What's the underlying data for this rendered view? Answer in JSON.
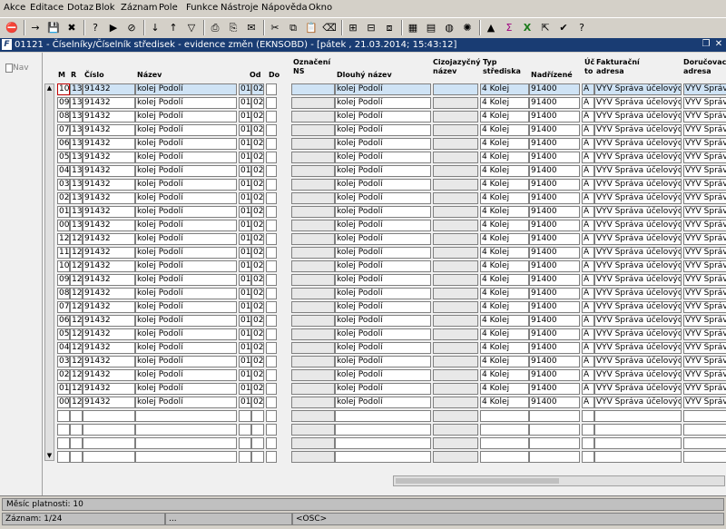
{
  "menu": [
    "Akce",
    "Editace",
    "Dotaz",
    "Blok",
    "Záznam",
    "Pole",
    "Funkce",
    "Nástroje",
    "Nápověda",
    "Okno"
  ],
  "window": {
    "title": "01121 - Číselníky/Číselník středisek - evidence změn (EKNSOBD) - [pátek , 21.03.2014; 15:43:12]"
  },
  "nav": {
    "label": "Nav"
  },
  "columns": {
    "m": "M",
    "r": "R",
    "cislo": "Číslo",
    "nazev": "Název",
    "od": "Od",
    "do": "Do",
    "oznaceni_ns": "Označení\nNS",
    "dlouhy_nazev": "Dlouhý název",
    "cizojazycny_nazev": "Cizojazyčný\nnázev",
    "typ_strediska": "Typ\nstřediska",
    "nadrizene": "Nadřízené",
    "ucto": "Úč\nto",
    "fakturacni_adresa": "Fakturační\nadresa",
    "dorucovaci_adresa": "Doručovac\nadresa"
  },
  "rows": [
    [
      "10",
      "13",
      "91432",
      "kolej Podolí",
      "01",
      "02",
      "",
      "kolej Podolí",
      "",
      "4 Kolej",
      "91400",
      "A",
      "VYV Správa účelových",
      "VYV Správ"
    ],
    [
      "09",
      "13",
      "91432",
      "kolej Podolí",
      "01",
      "02",
      "",
      "kolej Podolí",
      "",
      "4 Kolej",
      "91400",
      "A",
      "VYV Správa účelových",
      "VYV Správ"
    ],
    [
      "08",
      "13",
      "91432",
      "kolej Podolí",
      "01",
      "02",
      "",
      "kolej Podolí",
      "",
      "4 Kolej",
      "91400",
      "A",
      "VYV Správa účelových",
      "VYV Správ"
    ],
    [
      "07",
      "13",
      "91432",
      "kolej Podolí",
      "01",
      "02",
      "",
      "kolej Podolí",
      "",
      "4 Kolej",
      "91400",
      "A",
      "VYV Správa účelových",
      "VYV Správ"
    ],
    [
      "06",
      "13",
      "91432",
      "kolej Podolí",
      "01",
      "02",
      "",
      "kolej Podolí",
      "",
      "4 Kolej",
      "91400",
      "A",
      "VYV Správa účelových",
      "VYV Správ"
    ],
    [
      "05",
      "13",
      "91432",
      "kolej Podolí",
      "01",
      "02",
      "",
      "kolej Podolí",
      "",
      "4 Kolej",
      "91400",
      "A",
      "VYV Správa účelových",
      "VYV Správ"
    ],
    [
      "04",
      "13",
      "91432",
      "kolej Podolí",
      "01",
      "02",
      "",
      "kolej Podolí",
      "",
      "4 Kolej",
      "91400",
      "A",
      "VYV Správa účelových",
      "VYV Správ"
    ],
    [
      "03",
      "13",
      "91432",
      "kolej Podolí",
      "01",
      "02",
      "",
      "kolej Podolí",
      "",
      "4 Kolej",
      "91400",
      "A",
      "VYV Správa účelových",
      "VYV Správ"
    ],
    [
      "02",
      "13",
      "91432",
      "kolej Podolí",
      "01",
      "02",
      "",
      "kolej Podolí",
      "",
      "4 Kolej",
      "91400",
      "A",
      "VYV Správa účelových",
      "VYV Správ"
    ],
    [
      "01",
      "13",
      "91432",
      "kolej Podolí",
      "01",
      "02",
      "",
      "kolej Podolí",
      "",
      "4 Kolej",
      "91400",
      "A",
      "VYV Správa účelových",
      "VYV Správ"
    ],
    [
      "00",
      "13",
      "91432",
      "kolej Podolí",
      "01",
      "02",
      "",
      "kolej Podolí",
      "",
      "4 Kolej",
      "91400",
      "A",
      "VYV Správa účelových",
      "VYV Správ"
    ],
    [
      "12",
      "12",
      "91432",
      "kolej Podolí",
      "01",
      "02",
      "",
      "kolej Podolí",
      "",
      "4 Kolej",
      "91400",
      "A",
      "VYV Správa účelových",
      "VYV Správ"
    ],
    [
      "11",
      "12",
      "91432",
      "kolej Podolí",
      "01",
      "02",
      "",
      "kolej Podolí",
      "",
      "4 Kolej",
      "91400",
      "A",
      "VYV Správa účelových",
      "VYV Správ"
    ],
    [
      "10",
      "12",
      "91432",
      "kolej Podolí",
      "01",
      "02",
      "",
      "kolej Podolí",
      "",
      "4 Kolej",
      "91400",
      "A",
      "VYV Správa účelových",
      "VYV Správ"
    ],
    [
      "09",
      "12",
      "91432",
      "kolej Podolí",
      "01",
      "02",
      "",
      "kolej Podolí",
      "",
      "4 Kolej",
      "91400",
      "A",
      "VYV Správa účelových",
      "VYV Správ"
    ],
    [
      "08",
      "12",
      "91432",
      "kolej Podolí",
      "01",
      "02",
      "",
      "kolej Podolí",
      "",
      "4 Kolej",
      "91400",
      "A",
      "VYV Správa účelových",
      "VYV Správ"
    ],
    [
      "07",
      "12",
      "91432",
      "kolej Podolí",
      "01",
      "02",
      "",
      "kolej Podolí",
      "",
      "4 Kolej",
      "91400",
      "A",
      "VYV Správa účelových",
      "VYV Správ"
    ],
    [
      "06",
      "12",
      "91432",
      "kolej Podolí",
      "01",
      "02",
      "",
      "kolej Podolí",
      "",
      "4 Kolej",
      "91400",
      "A",
      "VYV Správa účelových",
      "VYV Správ"
    ],
    [
      "05",
      "12",
      "91432",
      "kolej Podolí",
      "01",
      "02",
      "",
      "kolej Podolí",
      "",
      "4 Kolej",
      "91400",
      "A",
      "VYV Správa účelových",
      "VYV Správ"
    ],
    [
      "04",
      "12",
      "91432",
      "kolej Podolí",
      "01",
      "02",
      "",
      "kolej Podolí",
      "",
      "4 Kolej",
      "91400",
      "A",
      "VYV Správa účelových",
      "VYV Správ"
    ],
    [
      "03",
      "12",
      "91432",
      "kolej Podolí",
      "01",
      "02",
      "",
      "kolej Podolí",
      "",
      "4 Kolej",
      "91400",
      "A",
      "VYV Správa účelových",
      "VYV Správ"
    ],
    [
      "02",
      "12",
      "91432",
      "kolej Podolí",
      "01",
      "02",
      "",
      "kolej Podolí",
      "",
      "4 Kolej",
      "91400",
      "A",
      "VYV Správa účelových",
      "VYV Správ"
    ],
    [
      "01",
      "12",
      "91432",
      "kolej Podolí",
      "01",
      "02",
      "",
      "kolej Podolí",
      "",
      "4 Kolej",
      "91400",
      "A",
      "VYV Správa účelových",
      "VYV Správ"
    ],
    [
      "00",
      "12",
      "91432",
      "kolej Podolí",
      "01",
      "02",
      "",
      "kolej Podolí",
      "",
      "4 Kolej",
      "91400",
      "A",
      "VYV Správa účelových",
      "VYV Správ"
    ]
  ],
  "empty_row_count": 4,
  "toolbar_icons": [
    "exit-icon",
    "separator",
    "arrow-icon",
    "save-icon",
    "cancel-icon",
    "separator",
    "enter-query-icon",
    "execute-query-icon",
    "cancel-query-icon",
    "separator",
    "sort-asc-icon",
    "sort-desc-icon",
    "filter-icon",
    "separator",
    "print-icon",
    "print-preview-icon",
    "mail-icon",
    "separator",
    "cut-icon",
    "copy-icon",
    "paste-icon",
    "clear-icon",
    "separator",
    "insert-record-icon",
    "delete-record-icon",
    "duplicate-icon",
    "separator",
    "calculator-icon",
    "calendar-icon",
    "globe-icon",
    "settings-icon",
    "separator",
    "chart-icon",
    "sigma-icon",
    "excel-icon",
    "export-icon",
    "check-icon",
    "help-icon"
  ],
  "status": {
    "field_info": "Měsíc platnosti: 10",
    "record": "Záznam: 1/24",
    "s2": "...",
    "osc": "<OSC>"
  },
  "colors": {
    "title_bar": "#193c73",
    "selected_cell_border": "#c00000"
  }
}
